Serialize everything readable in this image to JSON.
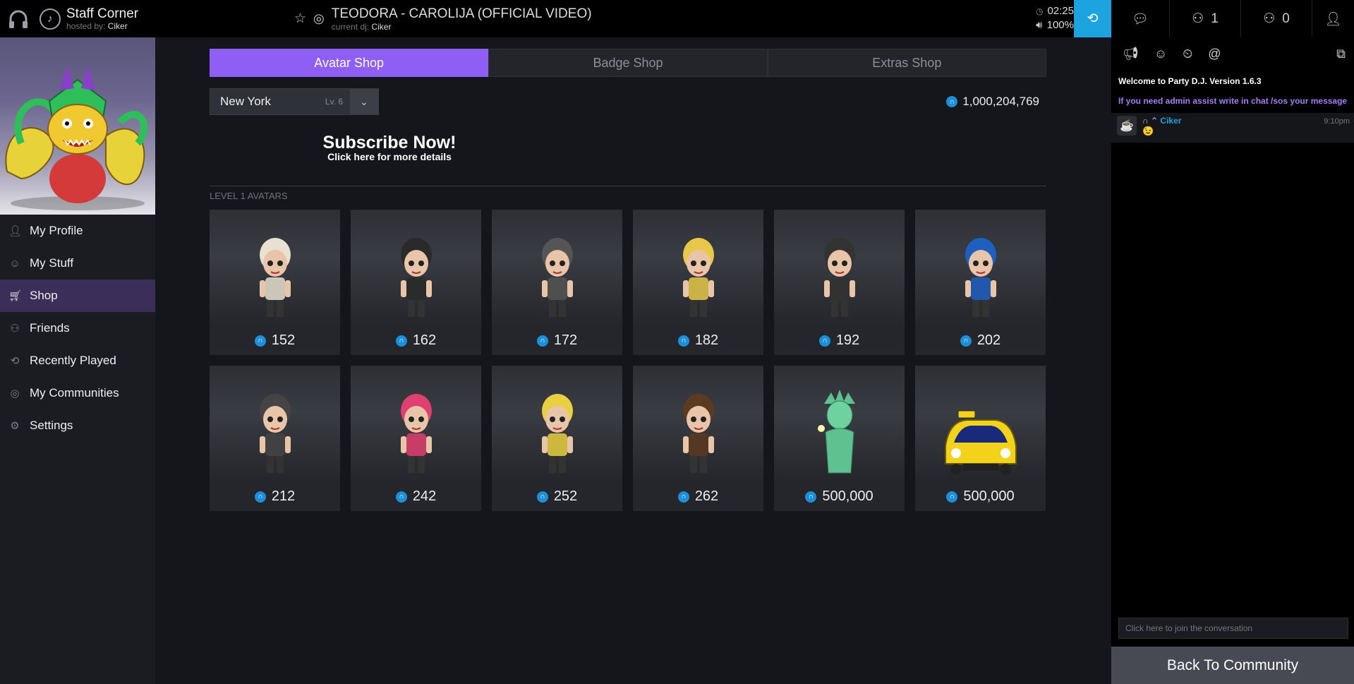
{
  "topbar": {
    "room_title": "Staff Corner",
    "hosted_by_label": "hosted by:",
    "host": "Ciker",
    "track_title": "TEODORA - CAROLIJA (OFFICIAL VIDEO)",
    "current_dj_label": "current dj:",
    "current_dj": "Ciker",
    "time": "02:25",
    "volume": "100%",
    "listeners_count": "1",
    "dj_queue_count": "0"
  },
  "sidebar": {
    "items": [
      {
        "label": "My Profile",
        "icon": "user-icon"
      },
      {
        "label": "My Stuff",
        "icon": "mask-icon"
      },
      {
        "label": "Shop",
        "icon": "cart-icon"
      },
      {
        "label": "Friends",
        "icon": "friends-icon"
      },
      {
        "label": "Recently Played",
        "icon": "history-icon"
      },
      {
        "label": "My Communities",
        "icon": "communities-icon"
      },
      {
        "label": "Settings",
        "icon": "gear-icon"
      }
    ],
    "active": "Shop"
  },
  "shop": {
    "tabs": [
      "Avatar Shop",
      "Badge Shop",
      "Extras Shop"
    ],
    "active_tab": "Avatar Shop",
    "collection": "New York",
    "collection_level": "Lv. 6",
    "balance": "1,000,204,769",
    "subscribe_title": "Subscribe Now!",
    "subscribe_sub": "Click here for more details",
    "section_label": "LEVEL 1 AVATARS",
    "items": [
      {
        "price": "152"
      },
      {
        "price": "162"
      },
      {
        "price": "172"
      },
      {
        "price": "182"
      },
      {
        "price": "192"
      },
      {
        "price": "202"
      },
      {
        "price": "212"
      },
      {
        "price": "242"
      },
      {
        "price": "252"
      },
      {
        "price": "262"
      },
      {
        "price": "500,000"
      },
      {
        "price": "500,000"
      }
    ]
  },
  "chat": {
    "welcome": "Welcome to Party D.J. Version 1.6.3",
    "assist": "If you need admin assist write in chat /sos your message",
    "messages": [
      {
        "user": "Ciker",
        "time": "9:10pm",
        "text": "😉"
      }
    ],
    "input_placeholder": "Click here to join the conversation",
    "back_button": "Back To Community"
  },
  "colors": {
    "accent_purple": "#8f5ef4",
    "accent_blue": "#1da3e0",
    "coin": "#1c8fd8"
  }
}
